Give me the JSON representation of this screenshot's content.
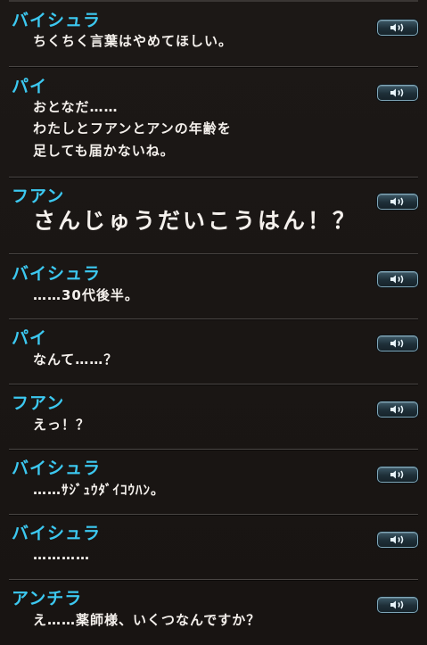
{
  "entries": [
    {
      "speaker": "バイシュラ",
      "lines": [
        "ちくちく言葉はやめてほしい。"
      ]
    },
    {
      "speaker": "パイ",
      "lines": [
        "おとなだ……",
        "わたしとフアンとアンの年齢を",
        "足しても届かないね。"
      ]
    },
    {
      "speaker": "フアン",
      "lines": [
        "さんじゅうだいこうはん！？"
      ]
    },
    {
      "speaker": "バイシュラ",
      "lines": [
        "……30代後半。"
      ]
    },
    {
      "speaker": "パイ",
      "lines": [
        "なんて……？"
      ]
    },
    {
      "speaker": "フアン",
      "lines": [
        "えっ！？"
      ]
    },
    {
      "speaker": "バイシュラ",
      "lines": [
        "……ｻｼﾞｭｳﾀﾞｲｺｳﾊﾝ。"
      ]
    },
    {
      "speaker": "バイシュラ",
      "lines": [
        "…………"
      ]
    },
    {
      "speaker": "アンチラ",
      "lines": [
        "え……薬師様、いくつなんですか？"
      ]
    }
  ],
  "voice_button": {
    "icon": "speaker-icon"
  },
  "colors": {
    "background": "#1a1614",
    "speaker_name": "#3cc8f0",
    "dialogue_text": "#f4f0ec",
    "divider": "#4a4644",
    "button_border": "#7fa6b8"
  }
}
